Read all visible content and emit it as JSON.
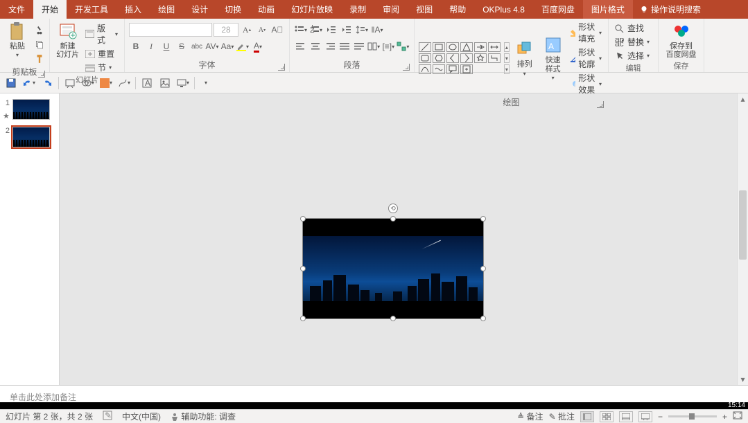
{
  "tabs": {
    "file": "文件",
    "home": "开始",
    "devtools": "开发工具",
    "insert": "插入",
    "draw": "绘图",
    "design": "设计",
    "transitions": "切换",
    "animations": "动画",
    "slideshow": "幻灯片放映",
    "record": "录制",
    "review": "审阅",
    "view": "视图",
    "help": "帮助",
    "okplus": "OKPlus 4.8",
    "baidu": "百度网盘",
    "picformat": "图片格式",
    "tellme": "操作说明搜索"
  },
  "ribbon": {
    "clipboard": {
      "paste": "粘贴",
      "label": "剪贴板"
    },
    "slides": {
      "new": "新建\n幻灯片",
      "layout": "版式",
      "reset": "重置",
      "section": "节",
      "label": "幻灯片"
    },
    "font": {
      "name_placeholder": "",
      "size_placeholder": "28",
      "label": "字体"
    },
    "paragraph": {
      "label": "段落"
    },
    "drawing": {
      "arrange": "排列",
      "quickstyle": "快速样式",
      "fill": "形状填充",
      "outline": "形状轮廓",
      "effects": "形状效果",
      "label": "绘图"
    },
    "editing": {
      "find": "查找",
      "replace": "替换",
      "select": "选择",
      "label": "编辑"
    },
    "save": {
      "saveto": "保存到\n百度网盘",
      "label": "保存"
    }
  },
  "slides": [
    {
      "num": "1"
    },
    {
      "num": "2"
    }
  ],
  "notes_placeholder": "单击此处添加备注",
  "status": {
    "slide_info": "幻灯片 第 2 张，共 2 张",
    "lang": "中文(中国)",
    "a11y": "辅助功能: 调查",
    "notes_btn": "备注",
    "comments_btn": "批注"
  },
  "clock": "15:14"
}
